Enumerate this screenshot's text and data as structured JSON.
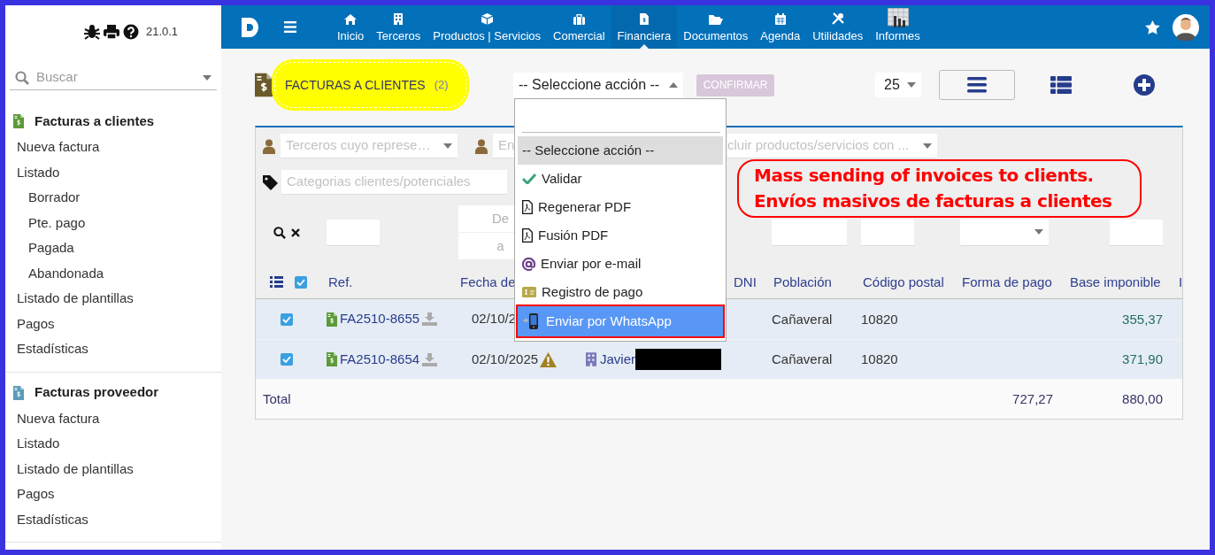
{
  "sidebar": {
    "version": "21.0.1",
    "search": {
      "placeholder": "Buscar"
    },
    "sections": [
      {
        "title": "Facturas a clientes",
        "kind": "customer",
        "items": [
          {
            "label": "Nueva factura"
          },
          {
            "label": "Listado",
            "children": [
              {
                "label": "Borrador"
              },
              {
                "label": "Pte. pago"
              },
              {
                "label": "Pagada"
              },
              {
                "label": "Abandonada"
              }
            ]
          },
          {
            "label": "Listado de plantillas"
          },
          {
            "label": "Pagos"
          },
          {
            "label": "Estadísticas"
          }
        ]
      },
      {
        "title": "Facturas proveedor",
        "kind": "supplier",
        "items": [
          {
            "label": "Nueva factura"
          },
          {
            "label": "Listado"
          },
          {
            "label": "Listado de plantillas"
          },
          {
            "label": "Pagos"
          },
          {
            "label": "Estadísticas"
          }
        ]
      }
    ]
  },
  "topbar": {
    "menu": [
      {
        "label": "Inicio",
        "selected": false
      },
      {
        "label": "Terceros",
        "selected": false
      },
      {
        "label": "Productos | Servicios",
        "selected": false
      },
      {
        "label": "Comercial",
        "selected": false
      },
      {
        "label": "Financiera",
        "selected": true
      },
      {
        "label": "Documentos",
        "selected": false
      },
      {
        "label": "Agenda",
        "selected": false
      },
      {
        "label": "Utilidades",
        "selected": false
      },
      {
        "label": "Informes",
        "selected": false
      }
    ]
  },
  "page": {
    "title": "FACTURAS A CLIENTES",
    "count": "(2)",
    "action_select": {
      "value": "-- Seleccione acción --"
    },
    "confirm_button": {
      "label": "CONFIRMAR",
      "disabled": true
    },
    "page_size": "25"
  },
  "action_menu": {
    "options": [
      {
        "label": "-- Seleccione acción --",
        "kind": "plain",
        "selected": true,
        "highlighted": false
      },
      {
        "label": "Validar",
        "kind": "validate",
        "selected": false,
        "highlighted": false
      },
      {
        "label": "Regenerar PDF",
        "kind": "pdf",
        "selected": false,
        "highlighted": false
      },
      {
        "label": "Fusión PDF",
        "kind": "pdf",
        "selected": false,
        "highlighted": false
      },
      {
        "label": "Enviar por e-mail",
        "kind": "email",
        "selected": false,
        "highlighted": false
      },
      {
        "label": "Registro de pago",
        "kind": "payment",
        "selected": false,
        "highlighted": false
      },
      {
        "label": "Enviar por WhatsApp",
        "kind": "whatsapp",
        "selected": false,
        "highlighted": true
      }
    ]
  },
  "filters": {
    "sales_rep": {
      "placeholder": "Terceros cuyo represe…"
    },
    "employee": {
      "placeholder": "En"
    },
    "products": {
      "placeholder": "cluir productos/servicios con ..."
    },
    "categories": {
      "placeholder": "Categorias clientes/potenciales"
    },
    "date_from": {
      "placeholder": "De"
    },
    "date_to": {
      "placeholder": "a"
    }
  },
  "table": {
    "all_checked": true,
    "columns": [
      "Ref.",
      "Fecha de",
      "DNI",
      "Población",
      "Código postal",
      "Forma de pago",
      "Base imponible",
      "I"
    ],
    "rows": [
      {
        "checked": true,
        "ref": "FA2510-8655",
        "date": "02/10/2",
        "town": "Cañaveral",
        "postal_code": "10820",
        "base": "355,37"
      },
      {
        "checked": true,
        "ref": "FA2510-8654",
        "date": "02/10/2025",
        "warning": true,
        "third_party": "Javier",
        "third_party_redacted": true,
        "town": "Cañaveral",
        "postal_code": "10820",
        "base": "371,90"
      }
    ],
    "total": {
      "label": "Total",
      "payment_total": "727,27",
      "base_total": "880,00"
    }
  },
  "annotation": {
    "lines": [
      "Mass sending of invoices to clients.",
      "Envíos masivos de facturas a clientes"
    ]
  }
}
